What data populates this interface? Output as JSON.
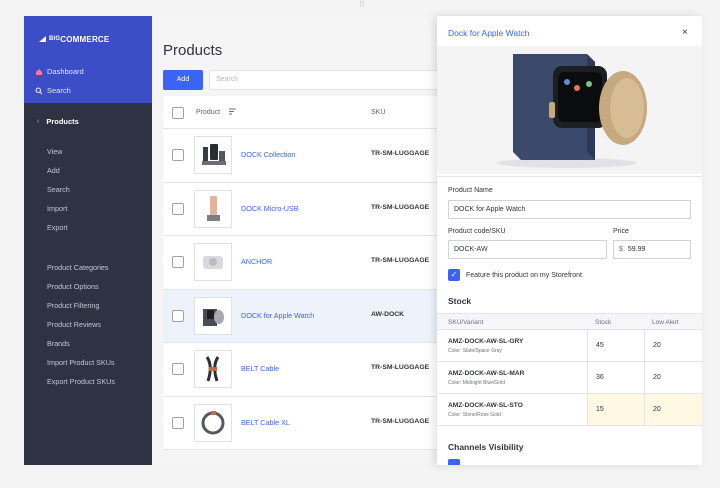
{
  "window": {
    "handle": "⠿"
  },
  "sidebar": {
    "logo_text": "COMMERCE",
    "logo_prefix": "BIG",
    "dashboard": "Dashboard",
    "search": "Search",
    "section": "Products",
    "sub_primary": [
      "View",
      "Add",
      "Search",
      "Import",
      "Export"
    ],
    "sub_secondary": [
      "Product Categories",
      "Product Options",
      "Product Filtering",
      "Product Reviews",
      "Brands",
      "Import Product SKUs",
      "Export Product SKUs"
    ]
  },
  "main": {
    "title": "Products",
    "add_label": "Add",
    "search_placeholder": "Search",
    "columns": {
      "product": "Product",
      "sku": "SKU"
    },
    "rows": [
      {
        "name": "DOCK Collection",
        "sku": "TR-SM-LUGGAGE",
        "selected": false
      },
      {
        "name": "DOCK Micro-USB",
        "sku": "TR-SM-LUGGAGE",
        "selected": false
      },
      {
        "name": "ANCHOR",
        "sku": "TR-SM-LUGGAGE",
        "selected": false
      },
      {
        "name": "DOCK for Apple Watch",
        "sku": "AW-DOCK",
        "selected": true
      },
      {
        "name": "BELT Cable",
        "sku": "TR-SM-LUGGAGE",
        "selected": false
      },
      {
        "name": "BELT Cable XL",
        "sku": "TR-SM-LUGGAGE",
        "selected": false
      }
    ]
  },
  "panel": {
    "title": "Dock for Apple Watch",
    "close": "×",
    "product_name_label": "Product Name",
    "product_name_value": "DOCK for Apple Watch",
    "sku_label": "Product code/SKU",
    "sku_value": "DOCK-AW",
    "price_label": "Price",
    "price_currency": "$",
    "price_value": "59.99",
    "feature_label": "Feature this product on my Storefront",
    "feature_checked": true,
    "stock_heading": "Stock",
    "stock_columns": {
      "variant": "SKU/Variant",
      "stock": "Stock",
      "low": "Low Alert"
    },
    "variants": [
      {
        "sku": "AMZ-DOCK-AW-SL-GRY",
        "color": "Color: Slate/Space Gray",
        "stock": "45",
        "low": "20",
        "highlight": false
      },
      {
        "sku": "AMZ-DOCK-AW-SL-MAR",
        "color": "Color: Midnight Blue/Gold",
        "stock": "36",
        "low": "20",
        "highlight": false
      },
      {
        "sku": "AMZ-DOCK-AW-SL-STO",
        "color": "Color: Stone/Rose Gold",
        "stock": "15",
        "low": "20",
        "highlight": true
      }
    ],
    "channels_heading": "Channels Visibility"
  },
  "colors": {
    "accent": "#3c64f4",
    "sidebar": "#2f3243",
    "sidebar_top": "#3b4ec7",
    "highlight": "#fff8e3"
  }
}
